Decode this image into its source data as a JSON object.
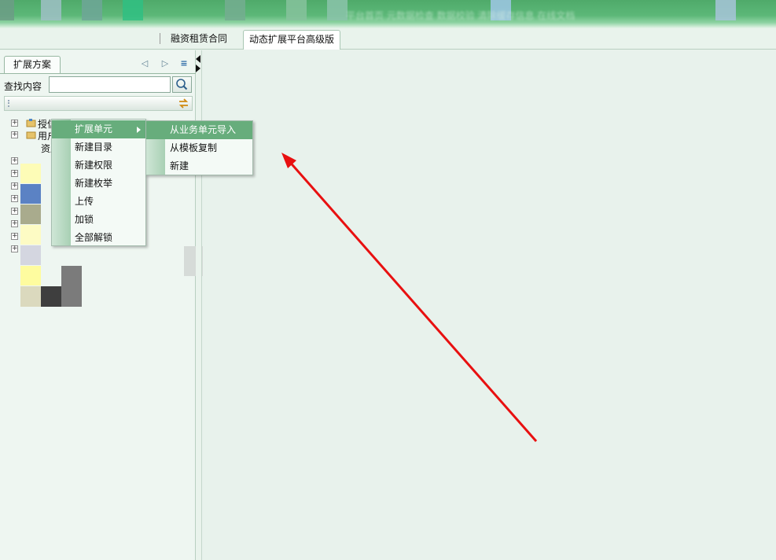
{
  "topbar": {
    "links_text": "平台首页    元数据检查    数据校验    清除缓存信息    在线文档"
  },
  "tabs": [
    {
      "label": "融资租赁合同"
    },
    {
      "label": "动态扩展平台高级版"
    }
  ],
  "left_panel": {
    "tab_label": "扩展方案",
    "search_label": "查找内容",
    "search_value": "",
    "tree": [
      {
        "label": "授信额度"
      },
      {
        "label": "用户"
      },
      {
        "label": "资产"
      }
    ]
  },
  "context_menu": {
    "items": [
      {
        "label": "扩展单元"
      },
      {
        "label": "新建目录"
      },
      {
        "label": "新建权限"
      },
      {
        "label": "新建枚举"
      },
      {
        "label": "上传"
      },
      {
        "label": "加锁"
      },
      {
        "label": "全部解锁"
      }
    ],
    "submenu": [
      {
        "label": "从业务单元导入"
      },
      {
        "label": "从模板复制"
      },
      {
        "label": "新建"
      }
    ]
  },
  "colors": {
    "accent_green": "#67ad7c",
    "annotation_arrow": "#e81010"
  },
  "icons": [
    "back-arrow-icon",
    "forward-arrow-icon",
    "list-icon",
    "search-icon",
    "refresh-icon",
    "folder-icon",
    "submenu-arrow-icon"
  ]
}
